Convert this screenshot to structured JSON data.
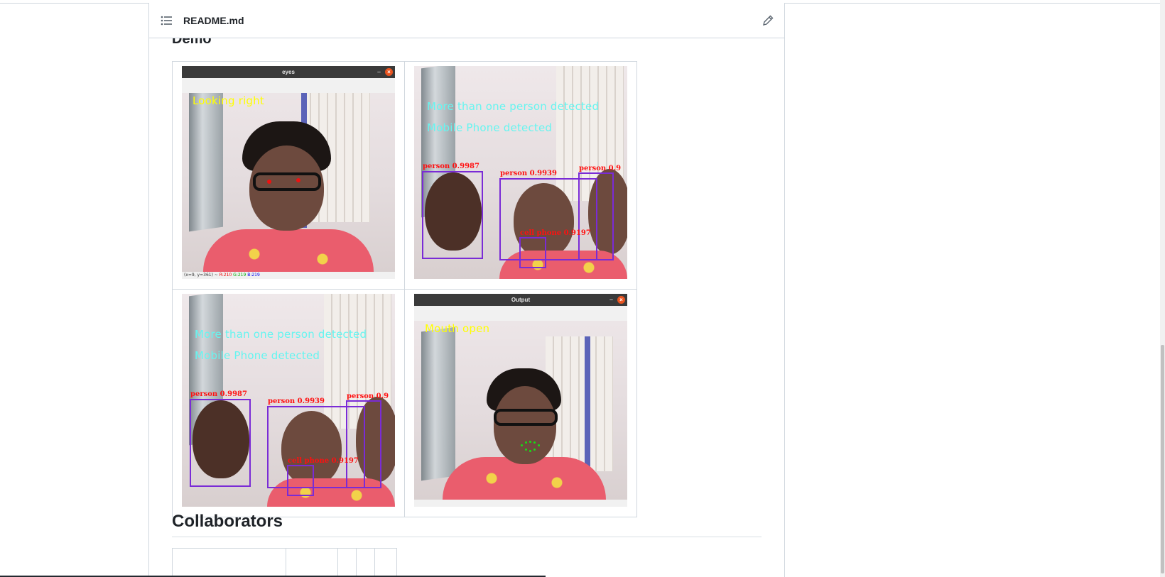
{
  "readme": {
    "filename": "README.md",
    "toc_icon": "list-icon",
    "edit_icon": "pencil-icon"
  },
  "demo": {
    "heading": "Demo",
    "images": [
      {
        "window_title": "eyes",
        "overlay_lines": [
          "Looking right"
        ],
        "status": "(x=9, y=361) ~ R:210 G:219 B:219",
        "status_parts": {
          "coords": "(x=9, y=361) ~",
          "r": "R:210",
          "g": "G:219",
          "b": "B:219"
        }
      },
      {
        "overlay_lines": [
          "More than one person detected",
          "Mobile Phone detected"
        ],
        "detections": [
          "person 0.9987",
          "person 0.9939",
          "person 0.9",
          "cell phone 0.9197"
        ]
      },
      {
        "overlay_lines": [
          "More than one person detected",
          "Mobile Phone detected"
        ],
        "detections": [
          "person 0.9987",
          "person 0.9939",
          "person 0.9",
          "cell phone 0.9197"
        ]
      },
      {
        "window_title": "Output",
        "overlay_lines": [
          "Mouth open"
        ]
      }
    ]
  },
  "collaborators": {
    "heading": "Collaborators"
  },
  "colors": {
    "overlay_yellow": "#ffff00",
    "overlay_cyan": "#66f5f0",
    "bbox": "#7a2bd6",
    "bbox_label": "#ff1010",
    "lip_landmarks": "#14e014"
  }
}
